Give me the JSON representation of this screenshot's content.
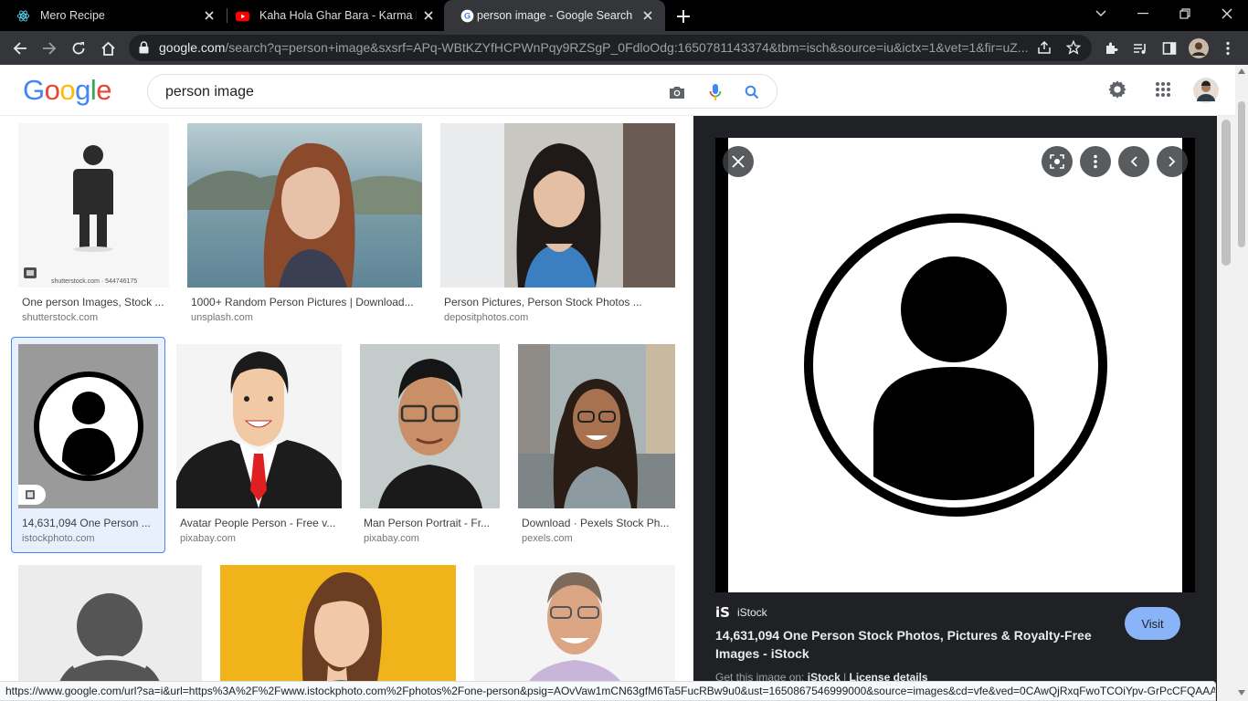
{
  "tabs": [
    {
      "title": "Mero Recipe",
      "icon": "react-icon"
    },
    {
      "title": "Kaha Hola Ghar Bara - Karma Band",
      "icon": "youtube-icon"
    },
    {
      "title": "person image - Google Search",
      "icon": "google-icon"
    }
  ],
  "address": {
    "host": "google.com",
    "path": "/search?q=person+image&sxsrf=APq-WBtKZYfHCPWnPqy9RZSgP_0FdloOdg:1650781143374&tbm=isch&source=iu&ictx=1&vet=1&fir=uZ..."
  },
  "google": {
    "logo": "Google",
    "query": "person image"
  },
  "results": [
    {
      "caption": "One person Images, Stock ...",
      "source": "shutterstock.com",
      "watermark": "shutterstock.com · 544746175"
    },
    {
      "caption": "1000+ Random Person Pictures | Download...",
      "source": "unsplash.com"
    },
    {
      "caption": "Person Pictures, Person Stock Photos ...",
      "source": "depositphotos.com"
    },
    {
      "caption": "14,631,094 One Person ...",
      "source": "istockphoto.com"
    },
    {
      "caption": "Avatar People Person - Free v...",
      "source": "pixabay.com"
    },
    {
      "caption": "Man Person Portrait - Fr...",
      "source": "pixabay.com"
    },
    {
      "caption": "Download · Pexels Stock Ph...",
      "source": "pexels.com"
    }
  ],
  "preview": {
    "source_name": "iStock",
    "title": "14,631,094 One Person Stock Photos, Pictures & Royalty-Free Images - iStock",
    "visit_label": "Visit",
    "get_label": "Get this image on:",
    "get_site": "iStock",
    "license": "License details"
  },
  "status_url": "https://www.google.com/url?sa=i&url=https%3A%2F%2Fwww.istockphoto.com%2Fphotos%2Fone-person&psig=AOvVaw1mCN63gfM6Ta5FucRBw9u0&ust=1650867546999000&source=images&cd=vfe&ved=0CAwQjRxqFwoTCOiYpv-GrPcCFQAAA...",
  "colors": {
    "accent": "#4285f4",
    "visit": "#8ab4f8",
    "preview_bg": "#202124"
  }
}
